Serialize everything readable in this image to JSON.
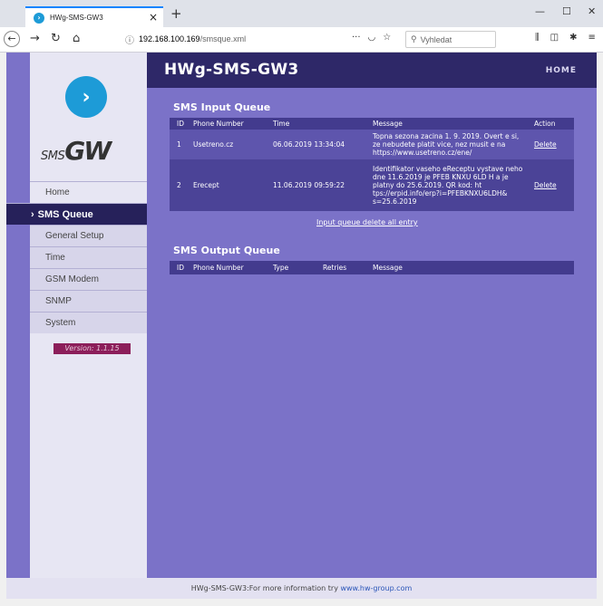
{
  "browser": {
    "tab_title": "HWg-SMS-GW3",
    "url_host": "192.168.100.169",
    "url_path": "/smsque.xml",
    "search_placeholder": "Vyhledat"
  },
  "app": {
    "title": "HWg-SMS-GW3",
    "home_label": "Home",
    "brand_prefix": "SMS",
    "brand_main": "GW"
  },
  "sidebar": {
    "items": [
      {
        "label": "Home"
      },
      {
        "label": "SMS Queue"
      },
      {
        "label": "General Setup"
      },
      {
        "label": "Time"
      },
      {
        "label": "GSM Modem"
      },
      {
        "label": "SNMP"
      },
      {
        "label": "System"
      }
    ],
    "version": "Version: 1.1.15"
  },
  "input_queue": {
    "title": "SMS Input Queue",
    "headers": [
      "ID",
      "Phone Number",
      "Time",
      "Message",
      "Action"
    ],
    "rows": [
      {
        "id": "1",
        "phone": "Usetreno.cz",
        "time": "06.06.2019 13:34:04",
        "message": "Topna sezona zacina 1. 9. 2019. Overt e si, ze nebudete platit vice, nez musit e na https://www.usetreno.cz/ene/",
        "action": "Delete"
      },
      {
        "id": "2",
        "phone": "Erecept",
        "time": "11.06.2019 09:59:22",
        "message": "Identifikator vaseho eReceptu vystave neho dne 11.6.2019 je PFEB KNXU 6LD H a je platny do 25.6.2019. QR kod: ht tps://erpid.info/erp?i=PFEBKNXU6LDH& s=25.6.2019",
        "action": "Delete"
      }
    ],
    "delete_all": "Input queue delete all entry"
  },
  "output_queue": {
    "title": "SMS Output Queue",
    "headers": [
      "ID",
      "Phone Number",
      "Type",
      "Retries",
      "Message"
    ]
  },
  "footer": {
    "text": "HWg-SMS-GW3:For more information try ",
    "link": "www.hw-group.com"
  },
  "colors": {
    "page_bg": "#7b72c8",
    "header_bg": "#2e2868",
    "sidebar_bg": "#e7e6f3",
    "active_nav": "#26215a",
    "version_badge": "#8c1e5a",
    "logo": "#1d9bd7"
  }
}
